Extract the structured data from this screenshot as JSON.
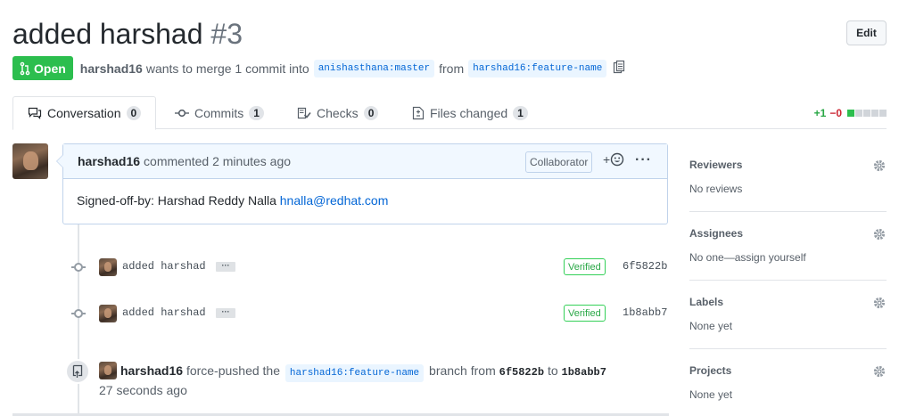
{
  "pr": {
    "title": "added harshad",
    "number": "#3",
    "edit_label": "Edit",
    "state": "Open",
    "author": "harshad16",
    "merge_text": "wants to merge 1 commit into",
    "base_branch": "anishasthana:master",
    "from_text": "from",
    "head_branch": "harshad16:feature-name"
  },
  "tabs": [
    {
      "label": "Conversation",
      "count": "0"
    },
    {
      "label": "Commits",
      "count": "1"
    },
    {
      "label": "Checks",
      "count": "0"
    },
    {
      "label": "Files changed",
      "count": "1"
    }
  ],
  "diffstat": {
    "additions": "+1",
    "deletions": "−0"
  },
  "comment": {
    "author": "harshad16",
    "action": "commented",
    "time": "2 minutes ago",
    "role": "Collaborator",
    "reaction": "+😀",
    "menu": "···",
    "body_text": "Signed-off-by: Harshad Reddy Nalla",
    "body_email": "hnalla@redhat.com"
  },
  "commits": [
    {
      "message": "added harshad",
      "ellipsis": "···",
      "verified": "Verified",
      "sha": "6f5822b"
    },
    {
      "message": "added harshad",
      "ellipsis": "···",
      "verified": "Verified",
      "sha": "1b8abb7"
    }
  ],
  "force_push": {
    "author": "harshad16",
    "action": "force-pushed the",
    "branch": "harshad16:feature-name",
    "branch_text": "branch from",
    "from_sha": "6f5822b",
    "to_text": "to",
    "to_sha": "1b8abb7",
    "time": "27 seconds ago"
  },
  "sidebar": [
    {
      "title": "Reviewers",
      "value": "No reviews"
    },
    {
      "title": "Assignees",
      "value": "No one—assign yourself"
    },
    {
      "title": "Labels",
      "value": "None yet"
    },
    {
      "title": "Projects",
      "value": "None yet"
    }
  ],
  "colors": {
    "open_green": "#2cbe4e",
    "link_blue": "#0366d6",
    "verified_green": "#28a745",
    "deletion_red": "#cb2431"
  },
  "diff_blocks_green": 1,
  "diff_blocks_total": 5
}
